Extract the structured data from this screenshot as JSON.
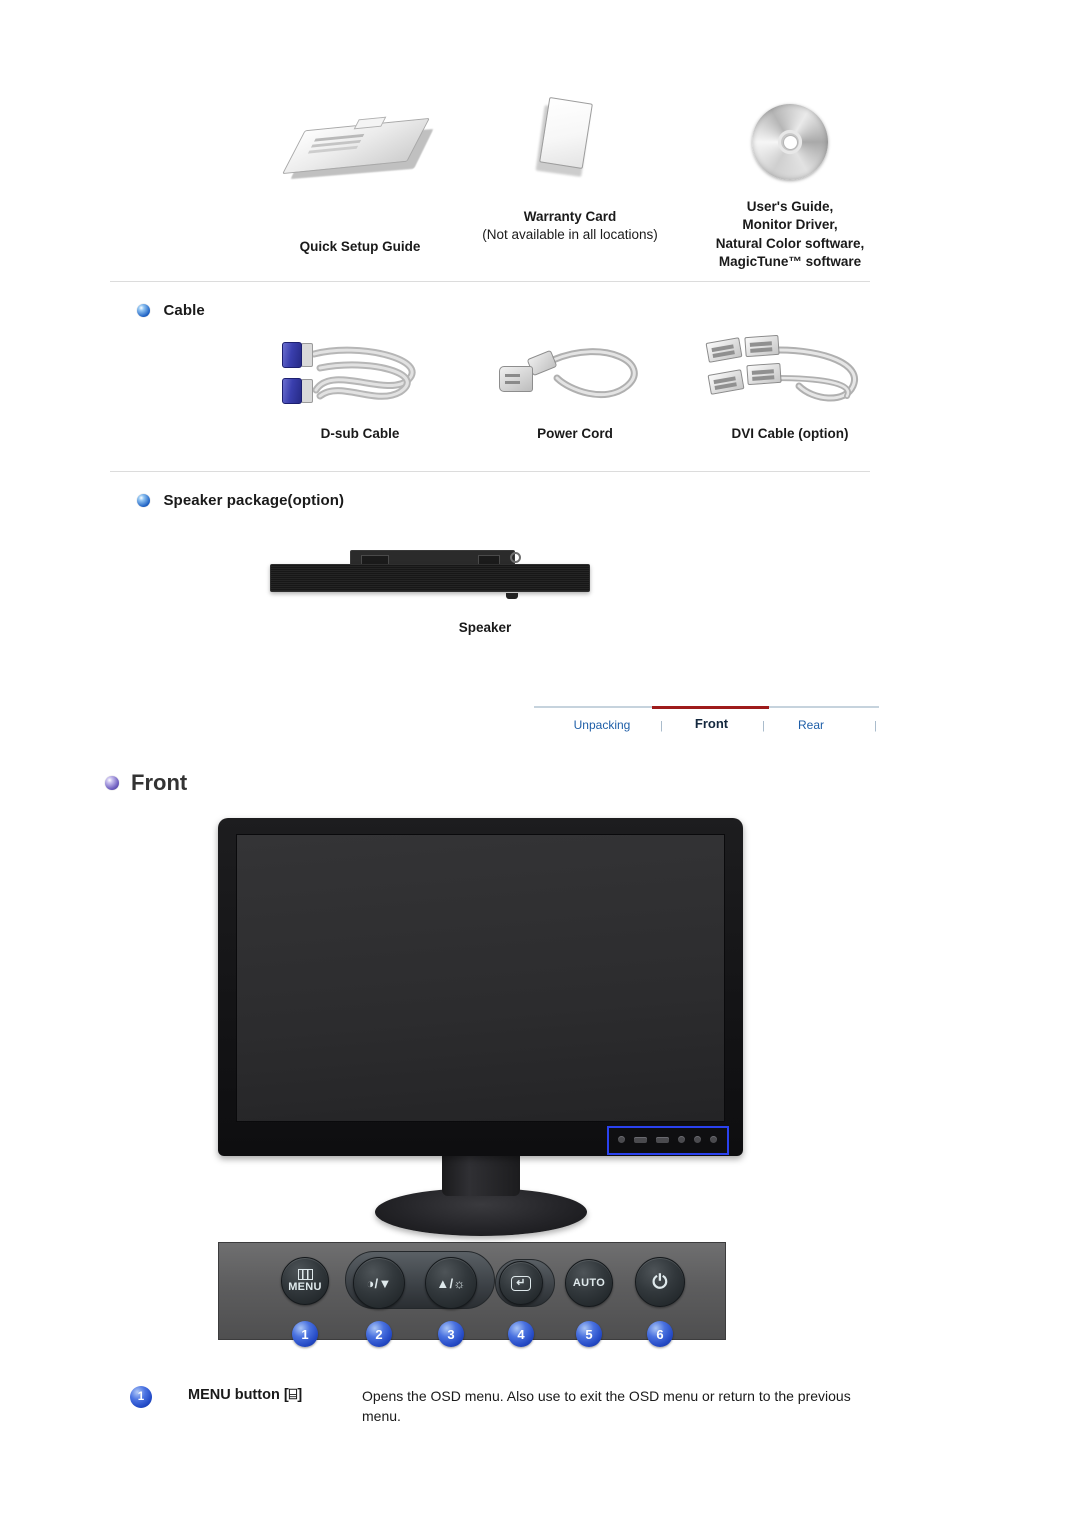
{
  "accessories": {
    "items": [
      {
        "icon": "booklet-icon",
        "caption_lines": [
          "Quick Setup Guide"
        ]
      },
      {
        "icon": "warranty-card-icon",
        "caption_bold": "Warranty Card",
        "caption_regular": "(Not available in all locations)"
      },
      {
        "icon": "cd-disc-icon",
        "caption_lines": [
          "User's Guide,",
          "Monitor Driver,",
          "Natural Color software,",
          "MagicTune™ software"
        ]
      }
    ]
  },
  "cable_section": {
    "heading": "Cable",
    "bullet_icon": "blue-sphere-bullet-icon",
    "items": [
      {
        "icon": "d-sub-cable-icon",
        "caption": "D-sub Cable"
      },
      {
        "icon": "power-cord-icon",
        "caption": "Power Cord"
      },
      {
        "icon": "dvi-cable-icon",
        "caption": "DVI Cable (option)"
      }
    ]
  },
  "speaker_section": {
    "heading": "Speaker package(option)",
    "bullet_icon": "blue-sphere-bullet-icon",
    "caption": "Speaker"
  },
  "tabnav": {
    "tabs": [
      {
        "label": "Unpacking",
        "active": false
      },
      {
        "label": "Front",
        "active": true
      },
      {
        "label": "Rear",
        "active": false
      }
    ],
    "separator": "|",
    "active_color": "#9e1b1b",
    "link_color": "#1f5fa8",
    "rule_color": "#c6d3dd"
  },
  "front_section": {
    "bullet_icon": "purple-sphere-bullet-icon",
    "title": "Front"
  },
  "monitor": {
    "highlight_color": "#2a42f0",
    "control_panel": {
      "buttons": [
        {
          "number": "1",
          "icon": "menu-grid-icon",
          "label": "MENU"
        },
        {
          "number": "2",
          "icon": "contrast-down-icon",
          "label": "◑/▼"
        },
        {
          "number": "3",
          "icon": "up-brightness-icon",
          "label": "▲/☼"
        },
        {
          "number": "4",
          "icon": "enter-icon",
          "label": "↵"
        },
        {
          "number": "5",
          "icon": "auto-icon",
          "label": "AUTO"
        },
        {
          "number": "6",
          "icon": "power-icon",
          "label": "⏻"
        }
      ]
    }
  },
  "description": {
    "rows": [
      {
        "number": "1",
        "label": "MENU button [⌸]",
        "text": "Opens the OSD menu. Also use to exit the OSD menu or return to the previous menu."
      }
    ]
  }
}
